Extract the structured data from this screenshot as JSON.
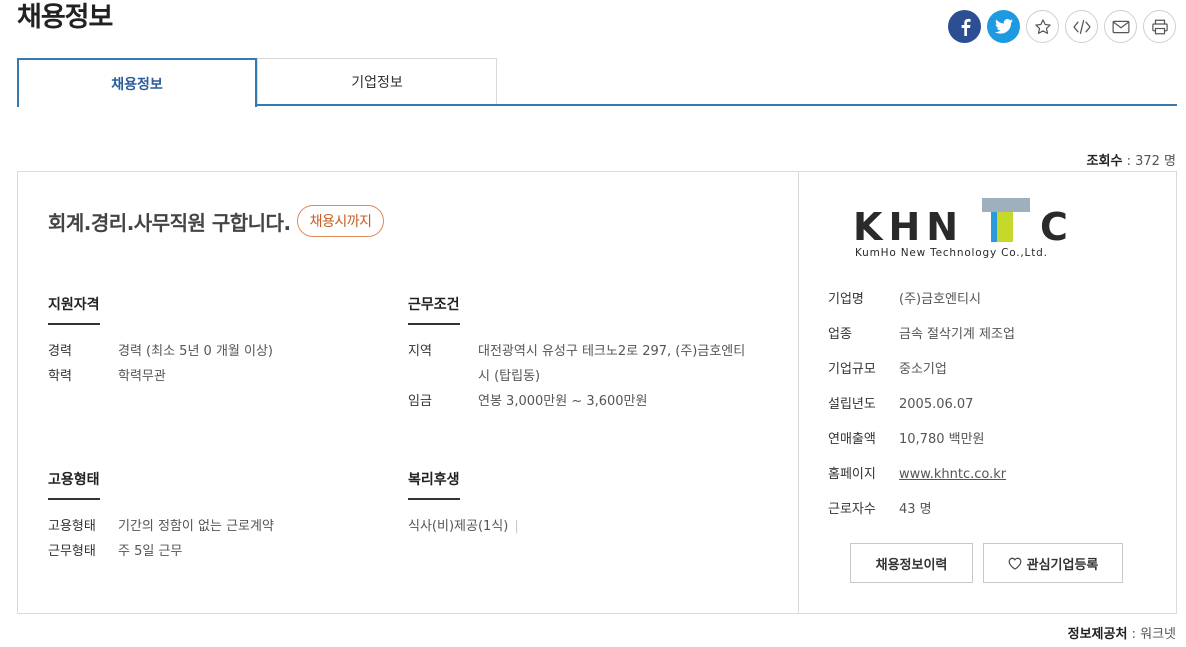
{
  "page_title": "채용정보",
  "tabs": [
    {
      "label": "채용정보",
      "active": true
    },
    {
      "label": "기업정보",
      "active": false
    }
  ],
  "views": {
    "label": "조회수",
    "value": "372 명"
  },
  "job": {
    "title": "회계.경리.사무직원 구합니다.",
    "deadline": "채용시까지"
  },
  "qualifications": {
    "heading": "지원자격",
    "rows": [
      {
        "label": "경력",
        "value": "경력 (최소 5년 0 개월 이상)"
      },
      {
        "label": "학력",
        "value": "학력무관"
      }
    ]
  },
  "conditions": {
    "heading": "근무조건",
    "rows": [
      {
        "label": "지역",
        "value_line1": "대전광역시 유성구 테크노2로 297, (주)금호엔티",
        "value_line2": "시 (탑립동)"
      },
      {
        "label": "임금",
        "value": "연봉 3,000만원 ~ 3,600만원"
      }
    ]
  },
  "employment": {
    "heading": "고용형태",
    "rows": [
      {
        "label": "고용형태",
        "value": "기간의 정함이 없는 근로계약"
      },
      {
        "label": "근무형태",
        "value": "주 5일 근무"
      }
    ]
  },
  "welfare": {
    "heading": "복리후생",
    "value": "식사(비)제공(1식)"
  },
  "company": {
    "logo_text": "KHNTC",
    "logo_sub": "KumHo New Technology Co.,Ltd.",
    "rows": [
      {
        "label": "기업명",
        "value": "(주)금호엔티시"
      },
      {
        "label": "업종",
        "value": "금속 절삭기계 제조업"
      },
      {
        "label": "기업규모",
        "value": "중소기업"
      },
      {
        "label": "설립년도",
        "value": "2005.06.07"
      },
      {
        "label": "연매출액",
        "value": "10,780 백만원"
      },
      {
        "label": "홈페이지",
        "value": "www.khntc.co.kr"
      },
      {
        "label": "근로자수",
        "value": "43 명"
      }
    ],
    "history_button": "채용정보이력",
    "fav_button": "관심기업등록"
  },
  "source": {
    "label": "정보제공처",
    "value": "워크넷"
  },
  "colors": {
    "accent": "#3679ae",
    "badge": "#e08b5a",
    "facebook": "#2c4e93",
    "twitter": "#1e9ae3"
  }
}
